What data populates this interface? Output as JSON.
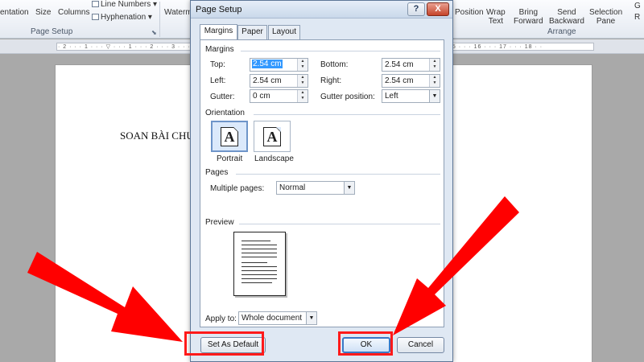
{
  "ribbon": {
    "orientation": "entation",
    "size": "Size",
    "columns": "Columns",
    "line_numbers": "Line Numbers",
    "hyphenation": "Hyphenation",
    "watermark": "Waterm",
    "position": "Position",
    "wrap_text": [
      "Wrap",
      "Text"
    ],
    "bring_forward": [
      "Bring",
      "Forward"
    ],
    "send_backward": [
      "Send",
      "Backward"
    ],
    "selection_pane": [
      "Selection",
      "Pane"
    ],
    "group_page_setup": "Page Setup",
    "group_arrange": "Arrange",
    "overflow": [
      "G",
      "R"
    ]
  },
  "document": {
    "heading": "SOAN BÀI CHU"
  },
  "dialog": {
    "title": "Page Setup",
    "help": "?",
    "close": "X",
    "tabs": [
      "Margins",
      "Paper",
      "Layout"
    ],
    "margins": {
      "heading": "Margins",
      "top_label": "Top:",
      "top_value": "2.54 cm",
      "bottom_label": "Bottom:",
      "bottom_value": "2.54 cm",
      "left_label": "Left:",
      "left_value": "2.54 cm",
      "right_label": "Right:",
      "right_value": "2.54 cm",
      "gutter_label": "Gutter:",
      "gutter_value": "0 cm",
      "gutter_position_label": "Gutter position:",
      "gutter_position_value": "Left"
    },
    "orientation": {
      "heading": "Orientation",
      "portrait": "Portrait",
      "landscape": "Landscape",
      "glyph": "A"
    },
    "pages": {
      "heading": "Pages",
      "multiple_pages_label": "Multiple pages:",
      "multiple_pages_value": "Normal"
    },
    "preview": {
      "heading": "Preview"
    },
    "apply_to_label": "Apply to:",
    "apply_to_value": "Whole document",
    "buttons": {
      "set_default": "Set As Default",
      "ok": "OK",
      "cancel": "Cancel"
    }
  },
  "colors": {
    "highlight": "#ff1a1a",
    "arrow": "#ff0000",
    "selection": "#3399ff"
  }
}
